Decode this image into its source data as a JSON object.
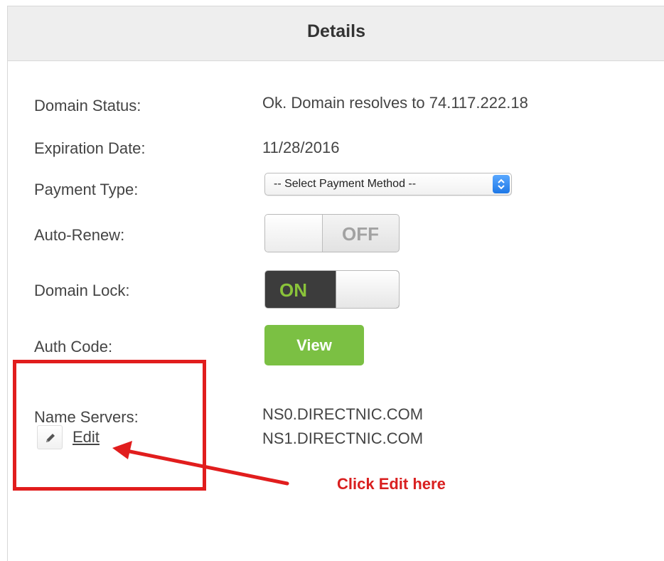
{
  "panel": {
    "title": "Details"
  },
  "fields": {
    "domain_status": {
      "label": "Domain Status:",
      "value": "Ok. Domain resolves to 74.117.222.18"
    },
    "expiration_date": {
      "label": "Expiration Date:",
      "value": "11/28/2016"
    },
    "payment_type": {
      "label": "Payment Type:",
      "selected": "-- Select Payment Method --"
    },
    "auto_renew": {
      "label": "Auto-Renew:",
      "state": "OFF"
    },
    "domain_lock": {
      "label": "Domain Lock:",
      "state": "ON"
    },
    "auth_code": {
      "label": "Auth Code:",
      "button": "View"
    },
    "name_servers": {
      "label": "Name Servers:",
      "edit_label": "Edit",
      "servers": [
        "NS0.DIRECTNIC.COM",
        "NS1.DIRECTNIC.COM"
      ]
    }
  },
  "annotation": {
    "note": "Click Edit here",
    "color": "#e11d1d"
  },
  "colors": {
    "header_bg": "#eeeeee",
    "view_button": "#7bc043",
    "toggle_on_text": "#8ac33a",
    "toggle_on_bg": "#3c3c3c",
    "select_arrow": "#1e78e6"
  },
  "icons": {
    "edit": "pencil-icon",
    "select": "chevron-up-down-icon"
  }
}
